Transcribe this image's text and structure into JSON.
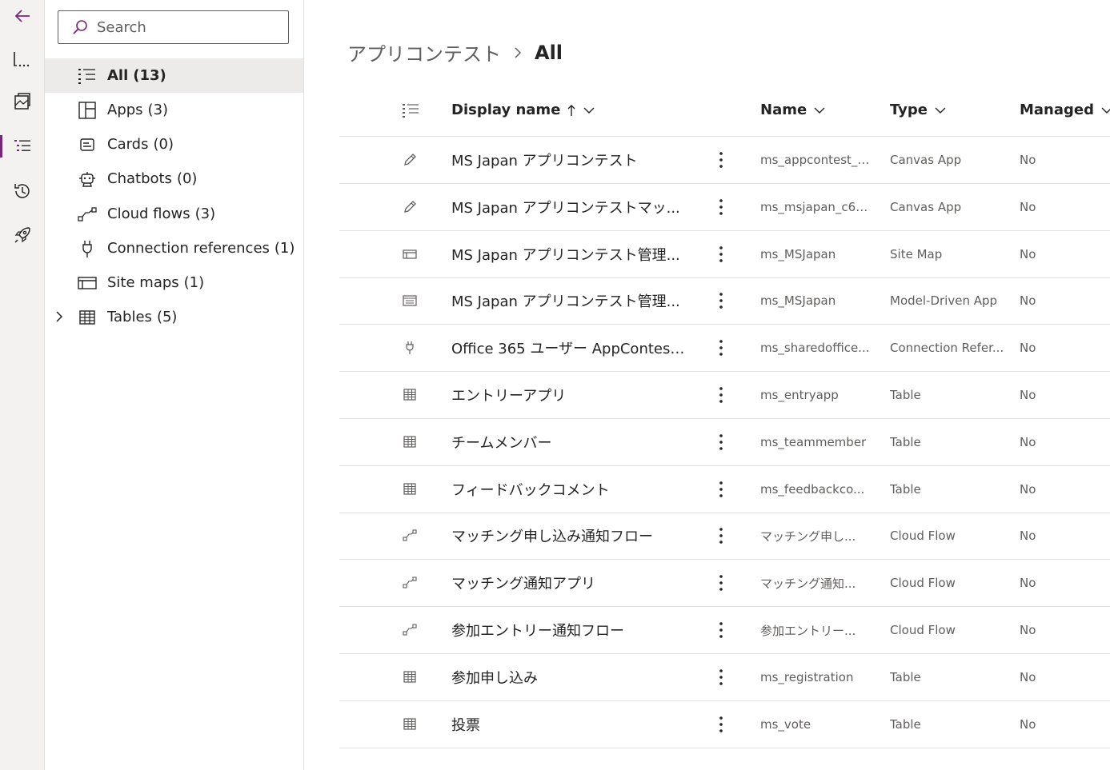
{
  "rail": {
    "items": [
      {
        "icon": "back-arrow-icon"
      },
      {
        "icon": "overview-icon"
      },
      {
        "icon": "objects-icon"
      },
      {
        "icon": "list-icon"
      },
      {
        "icon": "history-icon"
      },
      {
        "icon": "rocket-icon"
      }
    ]
  },
  "search": {
    "placeholder": "Search"
  },
  "nav": {
    "items": [
      {
        "label": "All",
        "count": "(13)",
        "icon": "list-icon"
      },
      {
        "label": "Apps",
        "count": "(3)",
        "icon": "apps-icon"
      },
      {
        "label": "Cards",
        "count": "(0)",
        "icon": "card-icon"
      },
      {
        "label": "Chatbots",
        "count": "(0)",
        "icon": "bot-icon"
      },
      {
        "label": "Cloud flows",
        "count": "(3)",
        "icon": "flow-icon"
      },
      {
        "label": "Connection references",
        "count": "(1)",
        "icon": "plug-icon"
      },
      {
        "label": "Site maps",
        "count": "(1)",
        "icon": "sitemap-icon"
      },
      {
        "label": "Tables",
        "count": "(5)",
        "icon": "table-icon"
      }
    ]
  },
  "breadcrumb": {
    "parent": "アプリコンテスト",
    "current": "All"
  },
  "table": {
    "headers": {
      "display_name": "Display name",
      "name": "Name",
      "type": "Type",
      "managed": "Managed"
    },
    "rows": [
      {
        "icon": "pencil-icon",
        "display": "MS Japan アプリコンテスト",
        "name": "ms_appcontest_3...",
        "type": "Canvas App",
        "managed": "No"
      },
      {
        "icon": "pencil-icon",
        "display": "MS Japan アプリコンテストマッ...",
        "name": "ms_msjapan_c60...",
        "type": "Canvas App",
        "managed": "No"
      },
      {
        "icon": "sitemap-icon",
        "display": "MS Japan アプリコンテスト管理...",
        "name": "ms_MSJapan",
        "type": "Site Map",
        "managed": "No"
      },
      {
        "icon": "model-app-icon",
        "display": "MS Japan アプリコンテスト管理...",
        "name": "ms_MSJapan",
        "type": "Model-Driven App",
        "managed": "No"
      },
      {
        "icon": "plug-icon",
        "display": "Office 365 ユーザー AppContest...",
        "name": "ms_sharedoffice...",
        "type": "Connection Refer...",
        "managed": "No"
      },
      {
        "icon": "table-icon",
        "display": "エントリーアプリ",
        "name": "ms_entryapp",
        "type": "Table",
        "managed": "No"
      },
      {
        "icon": "table-icon",
        "display": "チームメンバー",
        "name": "ms_teammember",
        "type": "Table",
        "managed": "No"
      },
      {
        "icon": "table-icon",
        "display": "フィードバックコメント",
        "name": "ms_feedbackco...",
        "type": "Table",
        "managed": "No"
      },
      {
        "icon": "flow-icon",
        "display": "マッチング申し込み通知フロー",
        "name": "マッチング申し...",
        "type": "Cloud Flow",
        "managed": "No"
      },
      {
        "icon": "flow-icon",
        "display": "マッチング通知アプリ",
        "name": "マッチング通知...",
        "type": "Cloud Flow",
        "managed": "No"
      },
      {
        "icon": "flow-icon",
        "display": "参加エントリー通知フロー",
        "name": "参加エントリー...",
        "type": "Cloud Flow",
        "managed": "No"
      },
      {
        "icon": "table-icon",
        "display": "参加申し込み",
        "name": "ms_registration",
        "type": "Table",
        "managed": "No"
      },
      {
        "icon": "table-icon",
        "display": "投票",
        "name": "ms_vote",
        "type": "Table",
        "managed": "No"
      }
    ]
  }
}
